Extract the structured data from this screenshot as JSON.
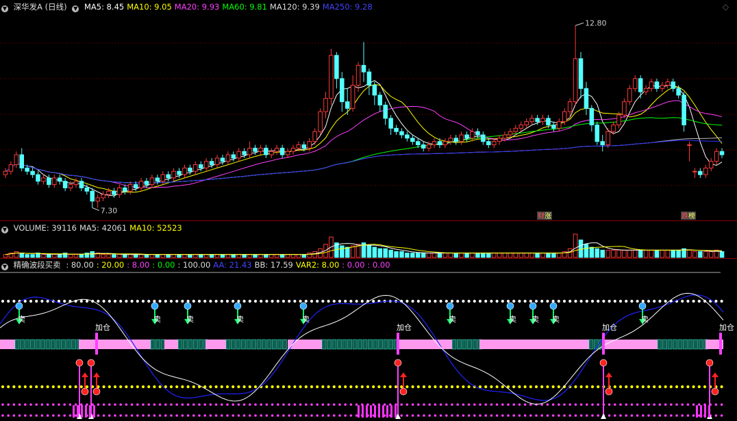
{
  "colors": {
    "up": "#ff3b3b",
    "down": "#54ffff",
    "ma5": "#ffffff",
    "ma10": "#ffff00",
    "ma20": "#ff40ff",
    "ma60": "#00ff00",
    "ma120": "#bbbbbb",
    "ma250": "#3333ff",
    "grid": "#8b0000"
  },
  "icons": {
    "collapse": "circle-down-icon",
    "window": "diamond-icon"
  },
  "price": {
    "title": "深华发A (日线)",
    "ma": [
      {
        "name": "MA5",
        "value": "8.45",
        "color": "#ffffff"
      },
      {
        "name": "MA10",
        "value": "9.05",
        "color": "#ffff00"
      },
      {
        "name": "MA20",
        "value": "9.93",
        "color": "#ff40ff"
      },
      {
        "name": "MA60",
        "value": "9.81",
        "color": "#00ff00"
      },
      {
        "name": "MA120",
        "value": "9.39",
        "color": "#dddddd"
      },
      {
        "name": "MA250",
        "value": "9.28",
        "color": "#4444ff"
      }
    ],
    "high_label": "12.80",
    "low_label": "7.30",
    "tags": [
      {
        "text": "财",
        "sub": "涨",
        "x": 790
      },
      {
        "text": "跌",
        "sub": "榜",
        "x": 1000
      }
    ]
  },
  "volume": {
    "legend": [
      {
        "name": "VOLUME",
        "value": "39116",
        "color": "#dddddd"
      },
      {
        "name": "MA5",
        "value": "42061",
        "color": "#dddddd"
      },
      {
        "name": "MA10",
        "value": "52523",
        "color": "#ffff00"
      }
    ]
  },
  "indicator": {
    "title": "精确波段买卖",
    "params": [
      {
        "text": ": 80.00",
        "color": "#dddddd"
      },
      {
        "text": ": 20.00",
        "color": "#ffff00"
      },
      {
        "text": ": 8.00",
        "color": "#ff40ff"
      },
      {
        "text": ": 0.00",
        "color": "#00ff00"
      },
      {
        "text": ": 100.00",
        "color": "#dddddd"
      },
      {
        "text": "AA: 21.43",
        "color": "#4444ff"
      },
      {
        "text": "BB: 17.59",
        "color": "#dddddd"
      },
      {
        "text": "VAR2: 8.00",
        "color": "#ffff00"
      },
      {
        "text": ": 0.00",
        "color": "#ff40ff"
      },
      {
        "text": ": 0.00",
        "color": "#ff40ff"
      }
    ],
    "sell_label": "卖",
    "add_label": "加仓"
  },
  "chart_data": {
    "type": "candlestick",
    "ylim": [
      7.0,
      13.2
    ],
    "candles": [
      [
        8.3,
        8.4,
        8.2,
        8.5
      ],
      [
        8.4,
        8.6,
        8.3,
        8.7
      ],
      [
        8.6,
        8.9,
        8.5,
        9.0
      ],
      [
        8.9,
        8.5,
        8.4,
        9.1
      ],
      [
        8.5,
        8.4,
        8.3,
        8.6
      ],
      [
        8.4,
        8.3,
        8.2,
        8.5
      ],
      [
        8.3,
        8.1,
        8.0,
        8.4
      ],
      [
        8.1,
        8.2,
        8.0,
        8.3
      ],
      [
        8.2,
        8.0,
        7.9,
        8.3
      ],
      [
        8.0,
        8.2,
        7.9,
        8.3
      ],
      [
        8.2,
        8.1,
        8.0,
        8.3
      ],
      [
        8.1,
        7.9,
        7.8,
        8.2
      ],
      [
        7.9,
        8.0,
        7.8,
        8.1
      ],
      [
        8.0,
        8.1,
        7.9,
        8.2
      ],
      [
        8.1,
        7.9,
        7.8,
        8.2
      ],
      [
        7.9,
        7.8,
        7.7,
        8.0
      ],
      [
        7.8,
        7.5,
        7.3,
        7.9
      ],
      [
        7.5,
        7.6,
        7.3,
        7.7
      ],
      [
        7.6,
        7.7,
        7.5,
        7.8
      ],
      [
        7.7,
        7.8,
        7.6,
        7.9
      ],
      [
        7.8,
        7.7,
        7.6,
        7.9
      ],
      [
        7.7,
        7.9,
        7.6,
        8.0
      ],
      [
        7.9,
        7.8,
        7.7,
        8.0
      ],
      [
        7.8,
        8.0,
        7.7,
        8.1
      ],
      [
        8.0,
        7.9,
        7.8,
        8.1
      ],
      [
        7.9,
        8.1,
        7.8,
        8.2
      ],
      [
        8.1,
        8.0,
        7.9,
        8.2
      ],
      [
        8.0,
        8.2,
        7.9,
        8.3
      ],
      [
        8.2,
        8.1,
        8.0,
        8.3
      ],
      [
        8.1,
        8.3,
        8.0,
        8.4
      ],
      [
        8.3,
        8.2,
        8.1,
        8.4
      ],
      [
        8.2,
        8.4,
        8.1,
        8.5
      ],
      [
        8.4,
        8.3,
        8.2,
        8.5
      ],
      [
        8.3,
        8.5,
        8.2,
        8.6
      ],
      [
        8.5,
        8.4,
        8.3,
        8.6
      ],
      [
        8.4,
        8.6,
        8.3,
        8.7
      ],
      [
        8.6,
        8.5,
        8.4,
        8.7
      ],
      [
        8.5,
        8.7,
        8.4,
        8.8
      ],
      [
        8.7,
        8.6,
        8.5,
        8.8
      ],
      [
        8.6,
        8.8,
        8.5,
        8.9
      ],
      [
        8.8,
        8.7,
        8.6,
        8.9
      ],
      [
        8.7,
        8.9,
        8.6,
        9.0
      ],
      [
        8.9,
        8.8,
        8.7,
        9.0
      ],
      [
        8.8,
        9.0,
        8.7,
        9.1
      ],
      [
        9.0,
        8.9,
        8.8,
        9.1
      ],
      [
        8.9,
        9.1,
        8.8,
        9.3
      ],
      [
        9.1,
        9.0,
        8.9,
        9.2
      ],
      [
        9.0,
        9.1,
        8.9,
        9.2
      ],
      [
        9.1,
        8.9,
        8.8,
        9.2
      ],
      [
        8.9,
        9.0,
        8.8,
        9.1
      ],
      [
        9.0,
        9.1,
        8.9,
        9.2
      ],
      [
        9.1,
        8.9,
        8.8,
        9.2
      ],
      [
        8.9,
        9.0,
        8.8,
        9.1
      ],
      [
        9.0,
        9.1,
        8.9,
        9.2
      ],
      [
        9.1,
        9.2,
        9.0,
        9.3
      ],
      [
        9.2,
        9.1,
        9.0,
        9.3
      ],
      [
        9.1,
        9.3,
        9.0,
        9.4
      ],
      [
        9.3,
        9.6,
        9.2,
        9.7
      ],
      [
        9.6,
        10.2,
        9.5,
        10.3
      ],
      [
        10.2,
        10.6,
        10.0,
        10.8
      ],
      [
        10.6,
        11.9,
        10.4,
        12.1
      ],
      [
        11.9,
        11.2,
        10.9,
        12.0
      ],
      [
        11.2,
        10.5,
        10.2,
        11.4
      ],
      [
        10.5,
        10.3,
        10.1,
        10.9
      ],
      [
        10.3,
        11.0,
        10.2,
        11.3
      ],
      [
        11.0,
        11.6,
        10.8,
        11.7
      ],
      [
        11.6,
        11.4,
        11.1,
        12.3
      ],
      [
        11.4,
        11.0,
        10.7,
        11.5
      ],
      [
        11.0,
        10.7,
        10.4,
        11.1
      ],
      [
        10.7,
        10.4,
        10.2,
        10.8
      ],
      [
        10.4,
        10.0,
        9.8,
        10.5
      ],
      [
        10.0,
        9.7,
        9.5,
        10.1
      ],
      [
        9.7,
        9.6,
        9.5,
        9.8
      ],
      [
        9.6,
        9.5,
        9.4,
        9.7
      ],
      [
        9.5,
        9.4,
        9.3,
        9.6
      ],
      [
        9.4,
        9.3,
        9.2,
        9.5
      ],
      [
        9.3,
        9.2,
        9.1,
        9.4
      ],
      [
        9.2,
        9.1,
        9.0,
        9.3
      ],
      [
        9.1,
        9.2,
        9.0,
        9.3
      ],
      [
        9.2,
        9.3,
        9.1,
        9.4
      ],
      [
        9.3,
        9.2,
        9.1,
        9.4
      ],
      [
        9.2,
        9.3,
        9.1,
        9.4
      ],
      [
        9.3,
        9.4,
        9.2,
        9.5
      ],
      [
        9.4,
        9.3,
        9.2,
        9.5
      ],
      [
        9.3,
        9.5,
        9.2,
        9.6
      ],
      [
        9.5,
        9.4,
        9.3,
        9.6
      ],
      [
        9.4,
        9.6,
        9.3,
        9.7
      ],
      [
        9.6,
        9.5,
        9.4,
        9.7
      ],
      [
        9.5,
        9.3,
        9.2,
        9.6
      ],
      [
        9.3,
        9.2,
        9.1,
        9.4
      ],
      [
        9.2,
        9.3,
        9.1,
        9.4
      ],
      [
        9.3,
        9.4,
        9.2,
        9.5
      ],
      [
        9.4,
        9.5,
        9.3,
        9.6
      ],
      [
        9.5,
        9.6,
        9.4,
        9.7
      ],
      [
        9.6,
        9.7,
        9.5,
        9.8
      ],
      [
        9.7,
        9.8,
        9.6,
        9.9
      ],
      [
        9.8,
        9.9,
        9.7,
        10.0
      ],
      [
        9.9,
        10.0,
        9.8,
        10.1
      ],
      [
        10.0,
        9.9,
        9.8,
        10.1
      ],
      [
        9.9,
        10.0,
        9.8,
        10.1
      ],
      [
        10.0,
        9.8,
        9.7,
        10.1
      ],
      [
        9.8,
        9.7,
        9.6,
        9.9
      ],
      [
        9.7,
        9.9,
        9.6,
        10.0
      ],
      [
        9.9,
        10.2,
        9.8,
        10.3
      ],
      [
        10.2,
        10.5,
        10.0,
        10.6
      ],
      [
        10.5,
        11.8,
        10.4,
        12.8
      ],
      [
        11.8,
        10.9,
        10.6,
        12.0
      ],
      [
        10.9,
        10.3,
        10.1,
        11.1
      ],
      [
        10.3,
        9.8,
        9.6,
        10.4
      ],
      [
        9.8,
        9.3,
        9.2,
        9.9
      ],
      [
        9.3,
        9.2,
        9.0,
        9.5
      ],
      [
        9.2,
        9.6,
        9.1,
        9.7
      ],
      [
        9.6,
        9.8,
        9.5,
        9.9
      ],
      [
        9.8,
        10.1,
        9.7,
        10.2
      ],
      [
        10.1,
        10.5,
        10.0,
        10.6
      ],
      [
        10.5,
        10.9,
        10.4,
        11.0
      ],
      [
        10.9,
        11.2,
        10.8,
        11.3
      ],
      [
        11.2,
        10.8,
        10.6,
        11.3
      ],
      [
        10.8,
        10.9,
        10.7,
        11.0
      ],
      [
        10.9,
        11.1,
        10.8,
        11.2
      ],
      [
        11.1,
        10.9,
        10.8,
        11.2
      ],
      [
        10.9,
        11.0,
        10.8,
        11.1
      ],
      [
        11.0,
        11.1,
        10.9,
        11.2
      ],
      [
        11.1,
        10.9,
        10.8,
        11.2
      ],
      [
        10.9,
        10.7,
        10.6,
        11.0
      ],
      [
        10.7,
        9.8,
        9.6,
        10.8
      ],
      [
        9.2,
        9.2,
        8.7,
        9.3
      ],
      [
        8.4,
        8.4,
        8.2,
        8.5
      ],
      [
        8.4,
        8.3,
        8.2,
        8.5
      ],
      [
        8.3,
        8.5,
        8.2,
        8.6
      ],
      [
        8.5,
        8.7,
        8.4,
        8.8
      ],
      [
        8.7,
        9.0,
        8.6,
        9.1
      ],
      [
        9.0,
        8.9,
        8.8,
        9.1
      ]
    ],
    "volumes": [
      2,
      3,
      4,
      3,
      2,
      2,
      3,
      2,
      2,
      2,
      2,
      3,
      2,
      2,
      2,
      3,
      4,
      3,
      2,
      2,
      2,
      2,
      2,
      2,
      2,
      2,
      2,
      2,
      2,
      2,
      2,
      2,
      2,
      2,
      2,
      2,
      2,
      2,
      2,
      2,
      2,
      2,
      2,
      2,
      2,
      2,
      2,
      2,
      2,
      2,
      2,
      2,
      2,
      2,
      2,
      2,
      3,
      4,
      6,
      9,
      14,
      10,
      8,
      7,
      8,
      9,
      10,
      8,
      7,
      6,
      6,
      5,
      4,
      4,
      3,
      3,
      3,
      3,
      3,
      3,
      3,
      3,
      3,
      3,
      3,
      3,
      3,
      3,
      3,
      3,
      3,
      3,
      3,
      3,
      3,
      3,
      3,
      3,
      3,
      3,
      3,
      3,
      3,
      4,
      6,
      16,
      12,
      9,
      7,
      6,
      5,
      5,
      5,
      5,
      5,
      5,
      5,
      5,
      5,
      5,
      5,
      5,
      5,
      5,
      5,
      6,
      5,
      4,
      4,
      4,
      4,
      5,
      4
    ],
    "sell_x": [
      28,
      226,
      274,
      347,
      443,
      657,
      745,
      778,
      808,
      938
    ],
    "add_x": [
      141,
      581,
      881,
      1052
    ],
    "buy_x": [
      116,
      133,
      581,
      881,
      1036
    ]
  }
}
